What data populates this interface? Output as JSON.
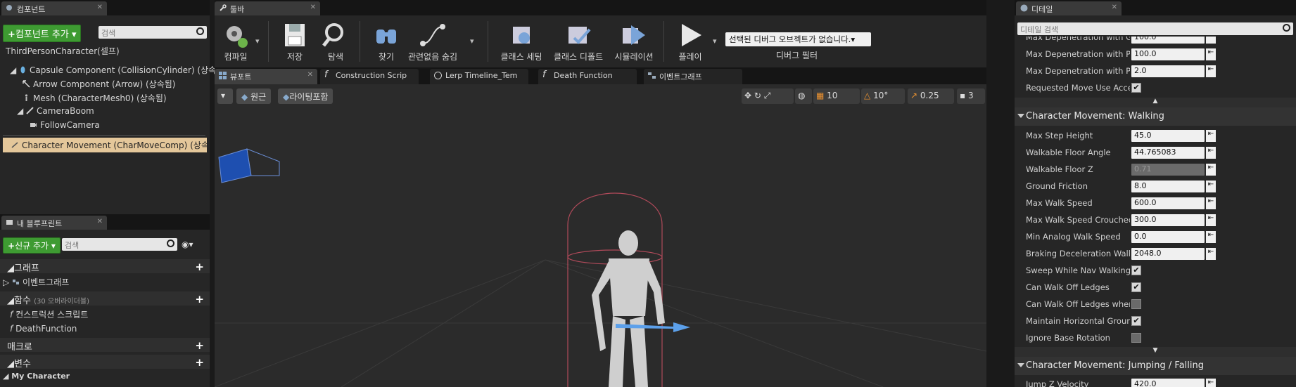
{
  "components_panel": {
    "tab_label": "컴포넌트",
    "add_button": "컴포넌트 추가",
    "search_placeholder": "검색",
    "items": [
      "ThirdPersonCharacter(셀프)",
      "Capsule Component (CollisionCylinder) (상속됨)",
      "Arrow Component (Arrow) (상속됨)",
      "Mesh (CharacterMesh0) (상속됨)",
      "CameraBoom",
      "FollowCamera",
      "Character Movement (CharMoveComp) (상속됨)"
    ]
  },
  "blueprint_panel": {
    "tab_label": "내 블루프린트",
    "add_button": "신규 추가",
    "search_placeholder": "검색",
    "graph_label": "그래프",
    "event_graph": "이벤트그래프",
    "functions_label": "함수",
    "functions_count": "(30 오버라이더블)",
    "functions": [
      "컨스트럭션 스크립트",
      "DeathFunction"
    ],
    "macros_label": "매크로",
    "variables_label": "변수",
    "my_character": "My Character"
  },
  "toolbar": {
    "tab_label": "툴바",
    "buttons": {
      "compile": "컴파일",
      "save": "저장",
      "browse": "탐색",
      "find": "찾기",
      "hide_unrelated": "관련없음 숨김",
      "class_settings": "클래스 세팅",
      "class_defaults": "클래스 디폴트",
      "simulation": "시뮬레이션",
      "play": "플레이"
    },
    "debug_select": "선택된 디버그 오브젝트가 없습니다.",
    "debug_filter": "디버그 필터"
  },
  "editor_tabs": [
    "뷰포트",
    "Construction Scrip",
    "Lerp Timeline_Tem",
    "Death Function",
    "이벤트그래프"
  ],
  "viewport": {
    "perspective": "원근",
    "lit": "라이팅포함",
    "grid_snap": "10",
    "rot_snap": "10°",
    "scale_snap": "0.25",
    "cam_speed": "3"
  },
  "details": {
    "tab_label": "디테일",
    "search_placeholder": "디테일 검색",
    "top_rows": [
      {
        "label": "Max Depenetration with Geo",
        "value": "100.0"
      },
      {
        "label": "Max Depenetration with Paw",
        "value": "100.0"
      },
      {
        "label": "Max Depenetration with Paw",
        "value": "2.0"
      },
      {
        "label": "Requested Move Use Accele",
        "checkbox": true
      }
    ],
    "walking_header": "Character Movement: Walking",
    "walking_rows": [
      {
        "label": "Max Step Height",
        "value": "45.0"
      },
      {
        "label": "Walkable Floor Angle",
        "value": "44.765083"
      },
      {
        "label": "Walkable Floor Z",
        "value": "0.71",
        "disabled": true
      },
      {
        "label": "Ground Friction",
        "value": "8.0"
      },
      {
        "label": "Max Walk Speed",
        "value": "600.0"
      },
      {
        "label": "Max Walk Speed Crouched",
        "value": "300.0"
      },
      {
        "label": "Min Analog Walk Speed",
        "value": "0.0"
      },
      {
        "label": "Braking Deceleration Walking",
        "value": "2048.0"
      },
      {
        "label": "Sweep While Nav Walking",
        "checkbox": true
      },
      {
        "label": "Can Walk Off Ledges",
        "checkbox": true
      },
      {
        "label": "Can Walk Off Ledges when C",
        "checkbox": false
      },
      {
        "label": "Maintain Horizontal Ground V",
        "checkbox": true
      },
      {
        "label": "Ignore Base Rotation",
        "checkbox": false
      }
    ],
    "jumping_header": "Character Movement: Jumping / Falling",
    "jump_row": {
      "label": "Jump Z Velocity",
      "value": "420.0"
    }
  }
}
